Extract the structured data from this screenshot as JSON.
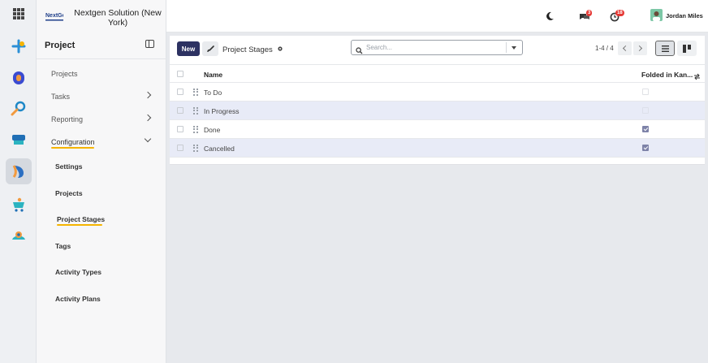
{
  "company": {
    "name": "Nextgen Solution (New York)",
    "logo_text": "NextGen"
  },
  "sidebar": {
    "title": "Project",
    "items": [
      {
        "label": "Projects",
        "has_chevron": false
      },
      {
        "label": "Tasks",
        "has_chevron": true
      },
      {
        "label": "Reporting",
        "has_chevron": true
      },
      {
        "label": "Configuration",
        "has_chevron": true,
        "expanded": true,
        "active": true
      }
    ],
    "sub_items": [
      {
        "label": "Settings"
      },
      {
        "label": "Projects"
      },
      {
        "label": "Project Stages",
        "active": true
      },
      {
        "label": "Tags"
      },
      {
        "label": "Activity Types"
      },
      {
        "label": "Activity Plans"
      }
    ]
  },
  "rail": {
    "apps": [
      "connect-app-icon",
      "discuss-app-icon",
      "search-app-icon",
      "pos-app-icon",
      "project-app-icon",
      "sales-app-icon",
      "crm-app-icon"
    ]
  },
  "topbar": {
    "messages_badge": "3",
    "activities_badge": "18",
    "user_name": "Jordan Miles"
  },
  "control": {
    "new_label": "New",
    "breadcrumb": "Project Stages",
    "search_placeholder": "Search...",
    "pager": "1-4 / 4"
  },
  "table": {
    "columns": {
      "name": "Name",
      "folded": "Folded in Kan..."
    },
    "rows": [
      {
        "name": "To Do",
        "folded": false
      },
      {
        "name": "In Progress",
        "folded": false
      },
      {
        "name": "Done",
        "folded": true
      },
      {
        "name": "Cancelled",
        "folded": true
      }
    ]
  },
  "colors": {
    "primary": "#2d3262",
    "accent_underline": "#f5b400",
    "row_highlight": "#e8ebf7"
  }
}
